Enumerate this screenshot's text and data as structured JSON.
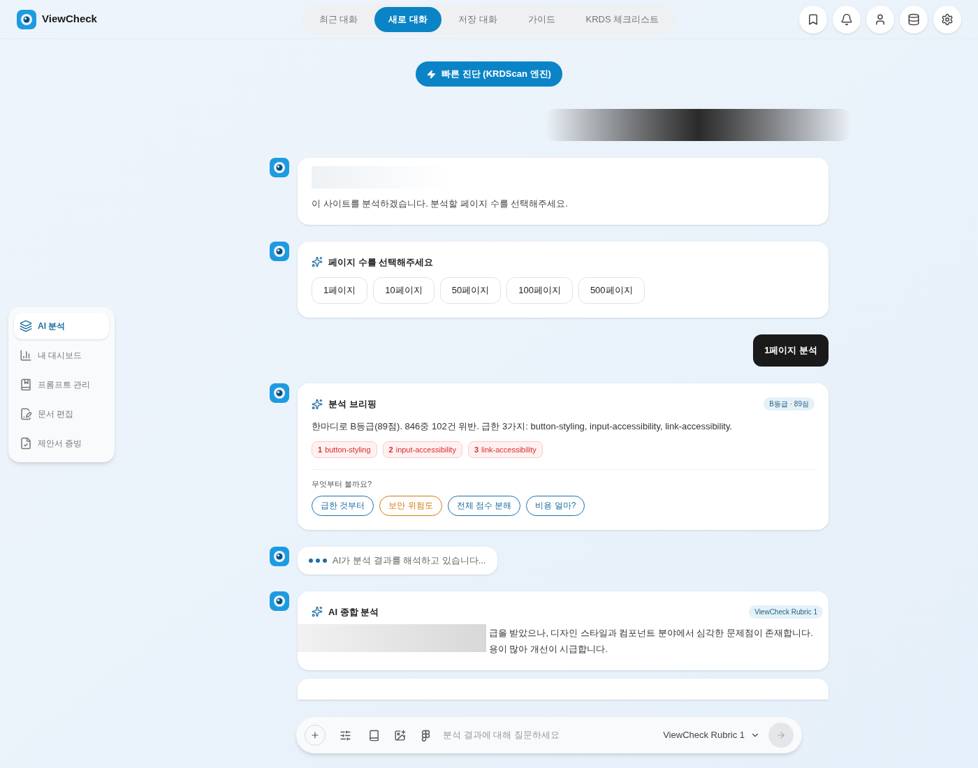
{
  "brand": {
    "name": "ViewCheck"
  },
  "nav_tabs": [
    {
      "label": "최근 대화",
      "selected": false
    },
    {
      "label": "새로 대화",
      "selected": true
    },
    {
      "label": "저장 대화",
      "selected": false
    },
    {
      "label": "가이드",
      "selected": false
    },
    {
      "label": "KRDS 체크리스트",
      "selected": false
    }
  ],
  "quick_scan_button": "빠른 진단 (KRDScan 엔진)",
  "sidebar": {
    "items": [
      {
        "label": "AI 분석",
        "selected": true
      },
      {
        "label": "내 대시보드",
        "selected": false
      },
      {
        "label": "프롬프트 관리",
        "selected": false
      },
      {
        "label": "문서 편집",
        "selected": false
      },
      {
        "label": "제안서 증빙",
        "selected": false
      }
    ]
  },
  "messages": [
    {
      "kind": "text",
      "text": "이 사이트를 분석하겠습니다. 분석할 페이지 수를 선택해주세요."
    },
    {
      "kind": "choices",
      "title": "페이지 수를 선택해주세요",
      "options": [
        "1페이지",
        "10페이지",
        "50페이지",
        "100페이지",
        "500페이지"
      ]
    },
    {
      "kind": "user",
      "text": "1페이지 분석"
    },
    {
      "kind": "briefing",
      "title": "분석 브리핑",
      "badge": "B등급 · 89점",
      "text": "한마디로 B등급(89점). 846중 102건 위반. 급한 3가지: button-styling, input-accessibility, link-accessibility.",
      "issues": [
        {
          "num": "1",
          "label": "button-styling"
        },
        {
          "num": "2",
          "label": "input-accessibility"
        },
        {
          "num": "3",
          "label": "link-accessibility"
        }
      ],
      "question": "무엇부터 볼까요?",
      "suggestions": [
        {
          "label": "급한 것부터",
          "color": "#1d6fa5"
        },
        {
          "label": "보안 위험도",
          "color": "#d97706"
        },
        {
          "label": "전체 점수 분해",
          "color": "#1d6fa5"
        },
        {
          "label": "비용 얼마?",
          "color": "#1d6fa5"
        }
      ]
    },
    {
      "kind": "typing",
      "text": "AI가 분석 결과를 해석하고 있습니다..."
    },
    {
      "kind": "summary",
      "title": "AI 종합 분석",
      "badge": "ViewCheck Rubric 1",
      "lines": [
        "급을 받았으나, 디자인 스타일과 컴포넌트 분야에서 심각한 문제점이 존재합니다.",
        "용이 많아 개선이 시급합니다."
      ]
    }
  ],
  "composer": {
    "placeholder": "분석 결과에 대해 질문하세요",
    "model": "ViewCheck Rubric 1"
  }
}
